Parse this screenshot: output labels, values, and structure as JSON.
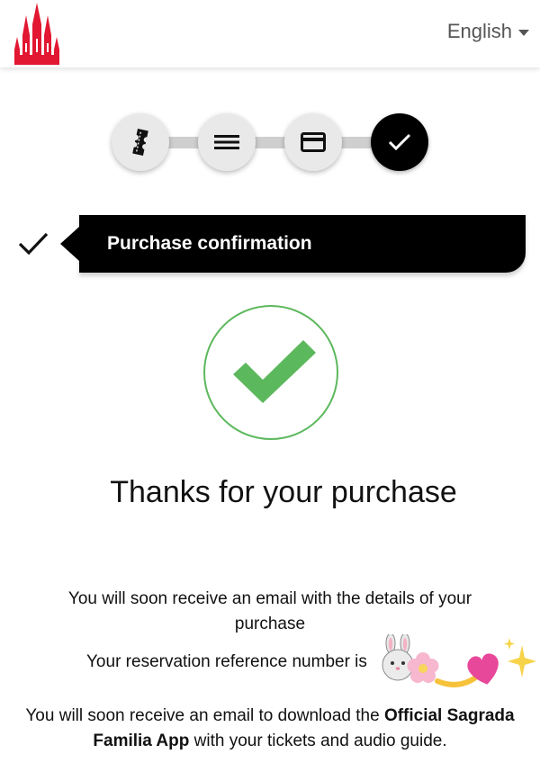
{
  "header": {
    "logo_name": "sagrada-familia-logo",
    "language": "English"
  },
  "steps": [
    {
      "icon": "ticket-icon",
      "state": "done"
    },
    {
      "icon": "list-icon",
      "state": "done"
    },
    {
      "icon": "credit-card-icon",
      "state": "done"
    },
    {
      "icon": "check-icon",
      "state": "active"
    }
  ],
  "section": {
    "title": "Purchase confirmation"
  },
  "confirmation": {
    "heading": "Thanks for your purchase",
    "email_notice": "You will soon receive an email with the details of your purchase",
    "reservation_notice": "Your reservation reference number is",
    "app_notice_prefix": "You will soon receive an email to download the",
    "app_name": "Official Sagrada Familia App",
    "app_notice_suffix": "with your tickets and audio guide."
  },
  "colors": {
    "brand_red": "#e21731",
    "success_green": "#5cb85c",
    "dark": "#000000",
    "step_grey": "#e9e9e9"
  }
}
